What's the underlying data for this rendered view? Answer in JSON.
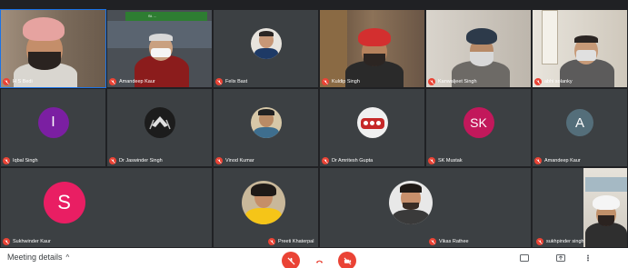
{
  "participants": [
    {
      "name": "H S Bedi"
    },
    {
      "name": "Amandeep Kaur",
      "banner": "St. ..."
    },
    {
      "name": "Felix Bast"
    },
    {
      "name": "Kuldip Singh"
    },
    {
      "name": "Kanwaljeet Singh"
    },
    {
      "name": "abhi solanky"
    },
    {
      "name": "Iqbal Singh",
      "initial": "I"
    },
    {
      "name": "Dr Jaswinder Singh"
    },
    {
      "name": "Vinod Kumar"
    },
    {
      "name": "Dr Amritesh Gupta"
    },
    {
      "name": "SK Mustak",
      "initial": "SK"
    },
    {
      "name": "Amandeep Kaur",
      "initial": "A"
    },
    {
      "name": "Sukhwinder Kaur",
      "initial": "S"
    },
    {
      "name": "Preeti Khaterpal"
    },
    {
      "name": "Vikas Rathee"
    },
    {
      "name": "sukhpinder singh"
    }
  ],
  "bottombar": {
    "meeting_details": "Meeting details",
    "caret": "^"
  },
  "colors": {
    "tile_bg": "#3c4043",
    "mic_off": "#ea4335",
    "iqbal_avatar": "#7b1fa2",
    "sk_avatar": "#c2185b",
    "a_avatar": "#546e7a",
    "s_avatar": "#e91e63",
    "hangup": "#ea4335"
  }
}
